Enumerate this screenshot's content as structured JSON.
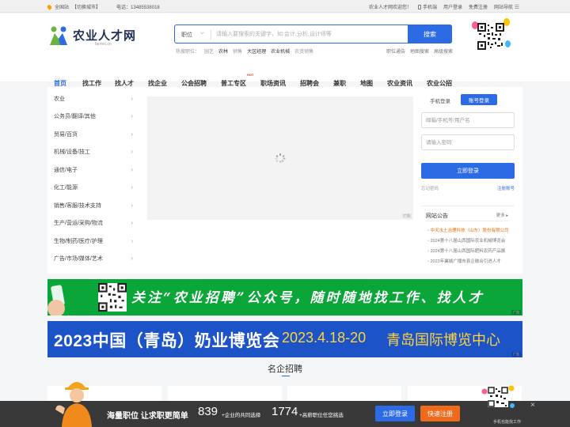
{
  "topbar": {
    "location": "全国站",
    "switch_city": "【切换城市】",
    "phone": "电话：13485538018",
    "welcome": "农业人才网欢迎您！",
    "mobile": "手机端",
    "user_login": "用户登录",
    "register": "免费注册",
    "site_nav": "网站导航"
  },
  "logo": {
    "title": "农业人才网",
    "subtitle": "farmrc.cn"
  },
  "search": {
    "category": "职位",
    "placeholder": "请输入要搜索的关键字，如:会计,分析,设计师等",
    "button": "搜索"
  },
  "hot": {
    "label": "热搜职位：",
    "items": [
      "园艺",
      "农林",
      "销售",
      "大区经理",
      "农业机械",
      "农资销售"
    ]
  },
  "quicklinks": [
    "职位通告",
    "地图搜索",
    "高级搜索"
  ],
  "nav": {
    "items": [
      "首页",
      "找工作",
      "找人才",
      "找企业",
      "公会招聘",
      "普工专区",
      "职场资讯",
      "招聘会",
      "兼职",
      "地图",
      "农业资讯",
      "农业公招"
    ],
    "hot_badge": "HOT"
  },
  "categories": [
    "农业",
    "公务员/翻译/其他",
    "贸易/百货",
    "机械/设备/技工",
    "通信/电子",
    "化工/能源",
    "销售/客服/技术支持",
    "生产/营运/采购/物流",
    "生物/制药/医疗/护理",
    "广告/市场/媒体/艺术"
  ],
  "banner_badge": "广告",
  "login": {
    "tab_mobile": "手机登录",
    "tab_account": "账号登录",
    "user_placeholder": "邮箱/手机号/用户名",
    "pass_placeholder": "请输入密码",
    "submit": "立即登录",
    "forgot": "忘记密码",
    "register": "注册账号"
  },
  "notice": {
    "title": "网站公告",
    "more": "更多",
    "items": [
      "中天水土治理科技（山东）股份有限公司",
      "2024第十八届山西国际农业机械博览会",
      "2024第十八届山西国际肥料农药产品展",
      "2023年襄城广播市县企融合引进人才"
    ]
  },
  "ad1": {
    "text": "关注“农业招聘”公众号，随时随地找工作、找人才",
    "tag": "广告"
  },
  "ad2": {
    "text1": "2023中国（青岛）奶业博览会",
    "text2": "2023.4.18-20",
    "text3": "青岛国际博览中心",
    "tag": "广告"
  },
  "section_title": "名企招聘",
  "bottom": {
    "slogan": "海量职位 让求职更简单",
    "num1": "839",
    "label1": "+企业的共同选择",
    "num2": "1774",
    "label2": "+高薪职位任您挑选",
    "login_btn": "立即登录",
    "register_btn": "快速注册",
    "qr_caption": "手机也能找工作",
    "close": "×"
  }
}
